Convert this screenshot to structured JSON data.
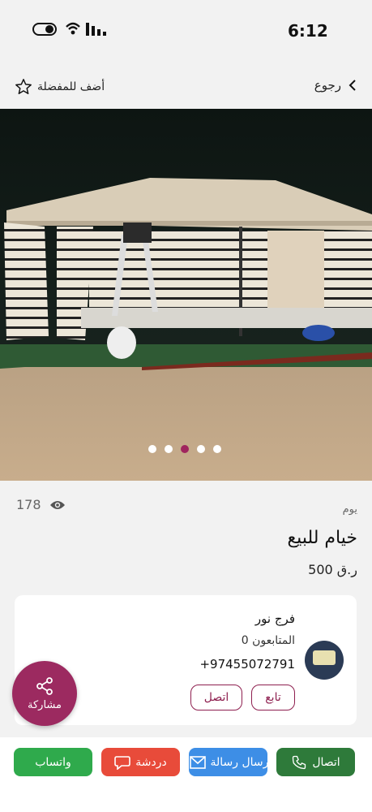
{
  "status": {
    "time": "6:12"
  },
  "nav": {
    "favorite_label": "أضف للمفضلة",
    "back_label": "رجوع"
  },
  "gallery": {
    "dots": 5,
    "active_index": 2
  },
  "listing": {
    "views": "178",
    "period": "يوم",
    "title": "خيام للبيع",
    "price": "500 ر.ق"
  },
  "seller": {
    "name": "فرج نور",
    "followers_label": "المتابعون",
    "followers_count": "0",
    "phone": "+97455072791",
    "follow_label": "تابع",
    "call_label": "اتصل"
  },
  "share": {
    "label": "مشاركة"
  },
  "actions": {
    "whatsapp": "واتساب",
    "chat": "دردشة",
    "message": "ارسال رسالة",
    "call": "اتصال"
  },
  "colors": {
    "brand": "#9c2a60",
    "whatsapp": "#2faa4c",
    "chat": "#e84b3a",
    "message": "#3d8ee6",
    "call": "#2e7a3a"
  }
}
